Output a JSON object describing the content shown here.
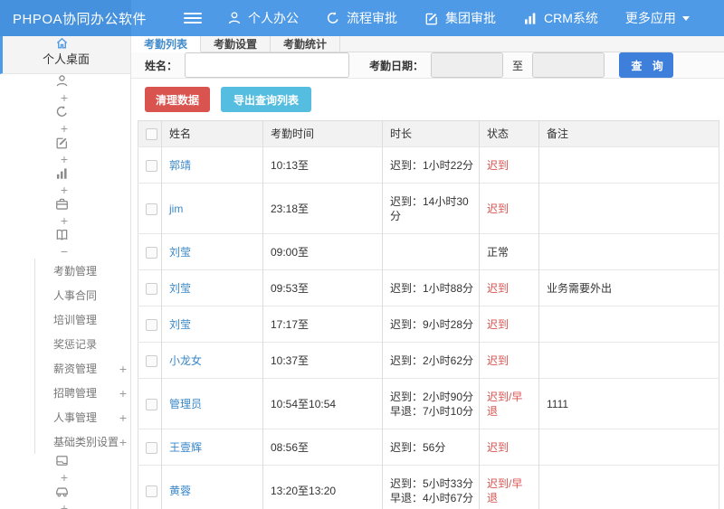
{
  "app": {
    "title": "PHPOA协同办公软件"
  },
  "topnav": {
    "items": [
      {
        "label": "个人办公",
        "icon": "user-icon"
      },
      {
        "label": "流程审批",
        "icon": "flow-icon"
      },
      {
        "label": "集团审批",
        "icon": "edit-icon"
      },
      {
        "label": "CRM系统",
        "icon": "chart-icon"
      },
      {
        "label": "更多应用",
        "icon": "",
        "caret": true
      }
    ]
  },
  "sidebar": {
    "items": [
      {
        "label": "个人桌面",
        "icon": "home-icon",
        "type": "main",
        "active": true
      },
      {
        "label": "个人办公",
        "icon": "user-icon",
        "type": "main",
        "expander": "+"
      },
      {
        "label": "流程审批",
        "icon": "flow-icon",
        "type": "main",
        "expander": "+"
      },
      {
        "label": "集团审批",
        "icon": "edit-icon",
        "type": "main",
        "expander": "+"
      },
      {
        "label": "CRM系统",
        "icon": "chart-icon",
        "type": "main",
        "expander": "+"
      },
      {
        "label": "行政办公",
        "icon": "briefcase-icon",
        "type": "main",
        "expander": "+"
      },
      {
        "label": "人力资源",
        "icon": "book-icon",
        "type": "main",
        "expander": "−"
      },
      {
        "label": "考勤管理",
        "type": "sub"
      },
      {
        "label": "人事合同",
        "type": "sub"
      },
      {
        "label": "培训管理",
        "type": "sub"
      },
      {
        "label": "奖惩记录",
        "type": "sub"
      },
      {
        "label": "薪资管理",
        "type": "sub",
        "expander": "+"
      },
      {
        "label": "招聘管理",
        "type": "sub",
        "expander": "+"
      },
      {
        "label": "人事管理",
        "type": "sub",
        "expander": "+"
      },
      {
        "label": "基础类别设置",
        "type": "sub",
        "expander": "+"
      },
      {
        "label": "公文管理",
        "icon": "doc-icon",
        "type": "main",
        "expander": "+"
      },
      {
        "label": "用车管理",
        "icon": "car-icon",
        "type": "main",
        "expander": "+"
      }
    ]
  },
  "tabs": [
    {
      "label": "考勤列表",
      "active": true
    },
    {
      "label": "考勤设置",
      "active": false
    },
    {
      "label": "考勤统计",
      "active": false
    }
  ],
  "filter": {
    "name_label": "姓名：",
    "name_value": "",
    "date_label": "考勤日期：",
    "date_from_value": "",
    "to_label": "至",
    "date_to_value": "",
    "search_button": "查 询"
  },
  "actions": {
    "clean_button": "清理数据",
    "export_button": "导出查询列表"
  },
  "table": {
    "columns": [
      "姓名",
      "考勤时间",
      "时长",
      "状态",
      "备注"
    ],
    "rows": [
      {
        "name": "郭靖",
        "time": "10:13至",
        "duration": "迟到：1小时22分",
        "status": "迟到",
        "status_type": "late",
        "note": ""
      },
      {
        "name": "jim",
        "time": "23:18至",
        "duration": "迟到：14小时30分",
        "status": "迟到",
        "status_type": "late",
        "note": ""
      },
      {
        "name": "刘莹",
        "time": "09:00至",
        "duration": "",
        "status": "正常",
        "status_type": "normal",
        "note": ""
      },
      {
        "name": "刘莹",
        "time": "09:53至",
        "duration": "迟到：1小时88分",
        "status": "迟到",
        "status_type": "late",
        "note": "业务需要外出"
      },
      {
        "name": "刘莹",
        "time": "17:17至",
        "duration": "迟到：9小时28分",
        "status": "迟到",
        "status_type": "late",
        "note": ""
      },
      {
        "name": "小龙女",
        "time": "10:37至",
        "duration": "迟到：2小时62分",
        "status": "迟到",
        "status_type": "late",
        "note": ""
      },
      {
        "name": "管理员",
        "time": "10:54至10:54",
        "duration": "迟到：2小时90分\n早退：7小时10分",
        "status": "迟到/早退",
        "status_type": "late",
        "note": "1111"
      },
      {
        "name": "王壹辉",
        "time": "08:56至",
        "duration": "迟到：56分",
        "status": "迟到",
        "status_type": "late",
        "note": ""
      },
      {
        "name": "黄蓉",
        "time": "13:20至13:20",
        "duration": "迟到：5小时33分\n早退：4小时67分",
        "status": "迟到/早退",
        "status_type": "late",
        "note": ""
      }
    ]
  },
  "colors": {
    "topbar_blue": "#4e9ae6",
    "accent_blue": "#428bca",
    "status_red": "#d9534f",
    "danger_red": "#d9534f",
    "info_teal": "#54bde0"
  }
}
